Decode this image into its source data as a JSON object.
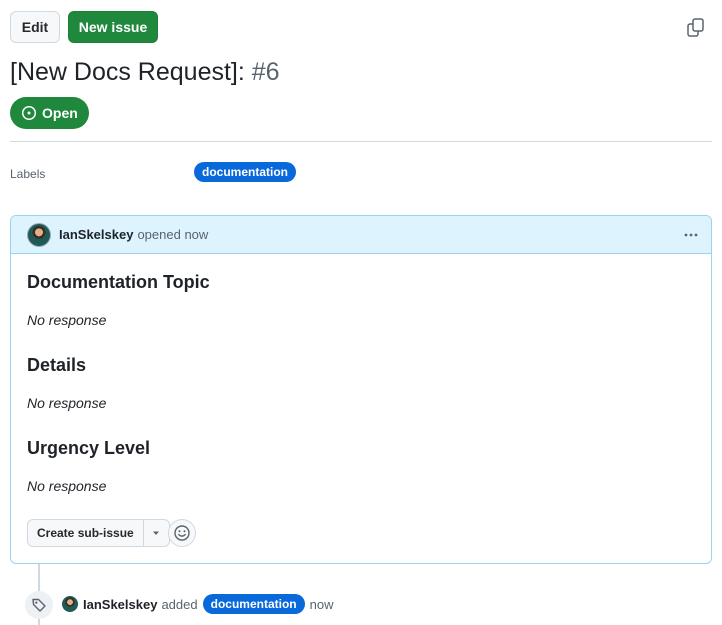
{
  "toolbar": {
    "edit_label": "Edit",
    "new_issue_label": "New issue"
  },
  "issue": {
    "title": "[New Docs Request]:",
    "number": "#6",
    "state": "Open"
  },
  "sidebar": {
    "labels_key": "Labels",
    "labels": [
      "documentation"
    ]
  },
  "comment": {
    "author": "IanSkelskey",
    "action": "opened now",
    "sections": [
      {
        "heading": "Documentation Topic",
        "value": "No response"
      },
      {
        "heading": "Details",
        "value": "No response"
      },
      {
        "heading": "Urgency Level",
        "value": "No response"
      }
    ],
    "create_sub_issue_label": "Create sub-issue"
  },
  "timeline": {
    "event": {
      "author": "IanSkelskey",
      "verb": "added",
      "label": "documentation",
      "time": "now"
    }
  },
  "colors": {
    "primary_green": "#1f883d",
    "label_blue": "#0969da",
    "comment_header_bg": "#ddf4ff",
    "comment_border": "#9cd2f2"
  },
  "icons": [
    "copy-icon",
    "issue-opened-icon",
    "kebab-horizontal-icon",
    "triangle-down-icon",
    "smiley-icon",
    "tag-icon"
  ]
}
